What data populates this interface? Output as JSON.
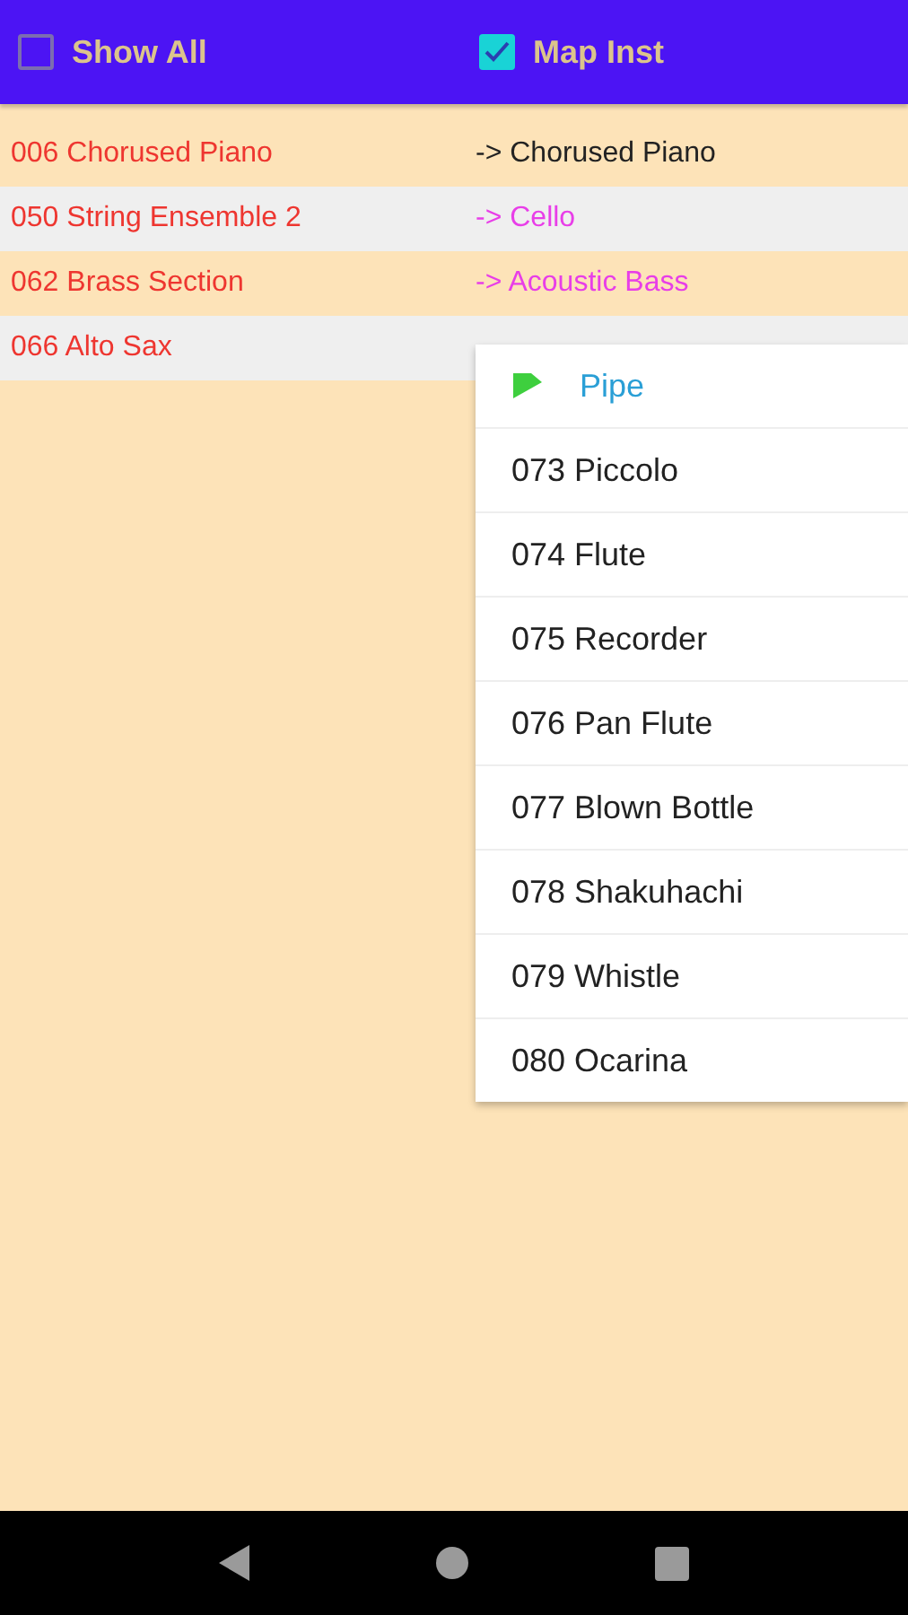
{
  "header": {
    "toggles": [
      {
        "label": "Show All",
        "checked": false
      },
      {
        "label": "Map Inst",
        "checked": true
      }
    ]
  },
  "rows": [
    {
      "instrument": "006 Chorused Piano",
      "mapping": "-> Chorused Piano",
      "color": "#222222"
    },
    {
      "instrument": "050 String Ensemble 2",
      "mapping": "-> Cello",
      "color": "#e83ee8"
    },
    {
      "instrument": "062 Brass Section",
      "mapping": "-> Acoustic Bass",
      "color": "#e83ee8"
    },
    {
      "instrument": "066 Alto Sax"
    }
  ],
  "dropdown": {
    "group": "Pipe",
    "items": [
      "073 Piccolo",
      "074 Flute",
      "075 Recorder",
      "076 Pan Flute",
      "077 Blown Bottle",
      "078 Shakuhachi",
      "079 Whistle",
      "080 Ocarina"
    ]
  }
}
